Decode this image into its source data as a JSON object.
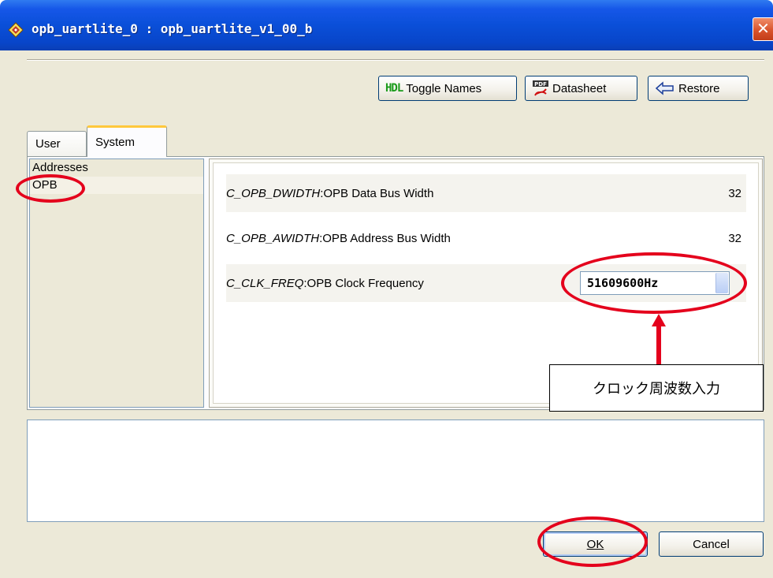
{
  "window": {
    "title": "opb_uartlite_0 : opb_uartlite_v1_00_b",
    "close_glyph": "✕"
  },
  "toolbar": {
    "hdl_icon_text": "HDL",
    "hdl_label": "Toggle Names",
    "pdf_icon_text": "PDF",
    "datasheet_label": "Datasheet",
    "restore_label": "Restore"
  },
  "tabs": [
    {
      "label": "User",
      "selected": false
    },
    {
      "label": "System",
      "selected": true
    }
  ],
  "categories": [
    {
      "label": "Addresses",
      "selected": false
    },
    {
      "label": "OPB",
      "selected": true
    }
  ],
  "params": [
    {
      "name": "C_OPB_DWIDTH",
      "desc": "OPB Data Bus Width",
      "value": "32"
    },
    {
      "name": "C_OPB_AWIDTH",
      "desc": "OPB Address Bus Width",
      "value": "32"
    },
    {
      "name": "C_CLK_FREQ",
      "desc": "OPB Clock Frequency",
      "value": "51609600Hz"
    }
  ],
  "buttons": {
    "ok_label": "OK",
    "cancel_label": "Cancel"
  },
  "annotation": {
    "callout_text": "クロック周波数入力",
    "color": "#e4001c"
  },
  "colors": {
    "titlebar": "#0a4fd8",
    "dialog_bg": "#ece9d8",
    "border": "#7f9db9"
  }
}
